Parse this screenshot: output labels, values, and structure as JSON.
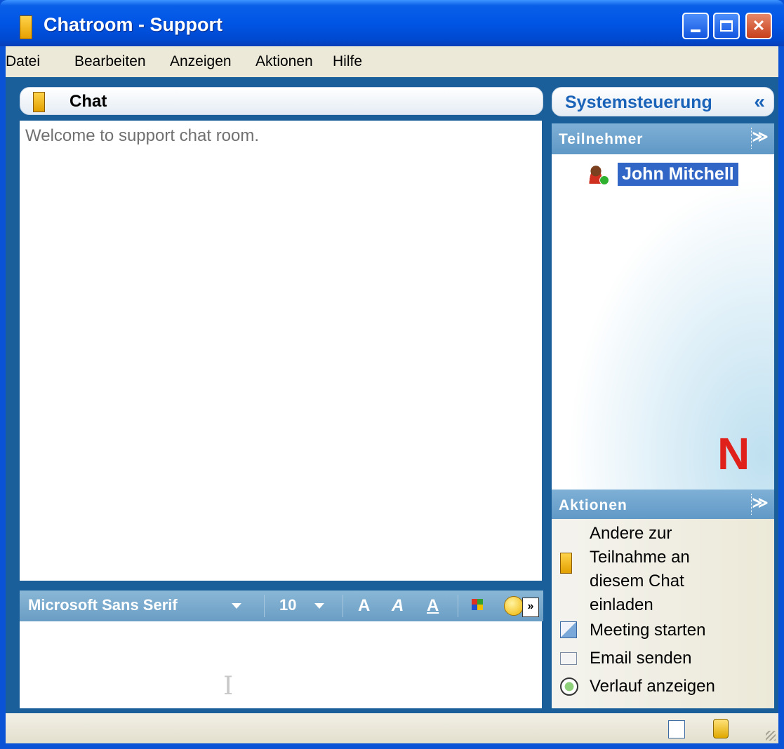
{
  "window": {
    "title": "Chatroom - Support",
    "minimize_label": "",
    "maximize_label": "",
    "close_label": "✕"
  },
  "menu": [
    "Datei",
    "Bearbeiten",
    "Anzeigen",
    "Aktionen",
    "Hilfe"
  ],
  "chat": {
    "header_title": "Chat",
    "messages": [
      "Welcome to support chat room."
    ]
  },
  "format_toolbar": {
    "font_name": "Microsoft Sans Serif",
    "font_size": "10",
    "bold_label": "A",
    "italic_label": "A",
    "underline_label": "A",
    "more_label": "»"
  },
  "control_panel": {
    "title": "Systemsteuerung",
    "collapse_label": "«",
    "participants_title": "Teilnehmer",
    "participants_toggle": "≫",
    "participants": [
      {
        "name": "John Mitchell",
        "status": "online",
        "status_color": "#2fb02f"
      }
    ],
    "brand_letter": "N",
    "actions_title": "Aktionen",
    "actions_toggle": "≫",
    "actions": [
      {
        "line1": "Andere zur",
        "line2": "Teilnahme an",
        "line3": "diesem Chat",
        "line4": "einladen",
        "icon": "chat-room-icon"
      },
      {
        "label": "Meeting starten",
        "icon": "meeting-icon"
      },
      {
        "label": "Email senden",
        "icon": "email-icon"
      },
      {
        "label": "Verlauf anzeigen",
        "icon": "history-icon"
      }
    ]
  },
  "colors": {
    "title_bar": "#0055e5",
    "panel_frame": "#1b5f9a",
    "section_header": "#6a9dc4",
    "selection": "#3166c6",
    "brand_red": "#e0201a"
  }
}
